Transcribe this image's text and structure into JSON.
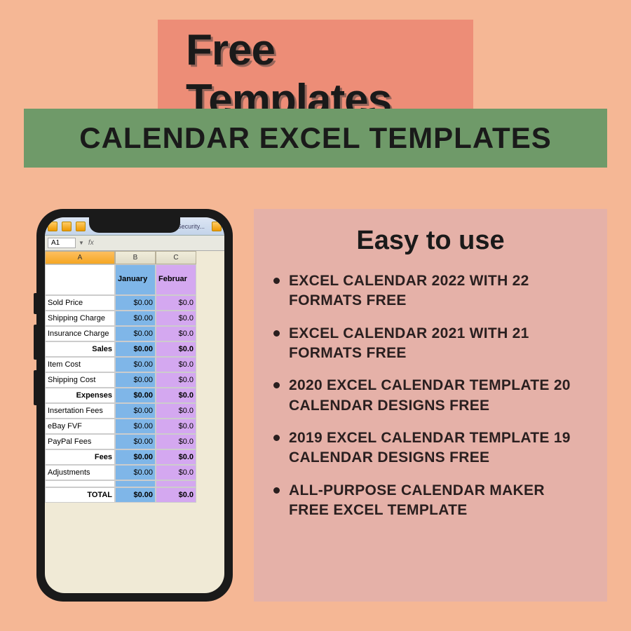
{
  "title": "Free Templates",
  "subtitle": "CALENDAR EXCEL TEMPLATES",
  "panel": {
    "heading": "Easy to use",
    "items": [
      "EXCEL CALENDAR 2022 WITH 22 FORMATS FREE",
      "EXCEL CALENDAR 2021 WITH 21 FORMATS FREE",
      "2020 EXCEL CALENDAR TEMPLATE 20 CALENDAR DESIGNS FREE",
      "2019 EXCEL CALENDAR TEMPLATE 19 CALENDAR DESIGNS FREE",
      "ALL-PURPOSE CALENDAR MAKER FREE EXCEL TEMPLATE"
    ]
  },
  "spreadsheet": {
    "toolbar_security": "Security...",
    "cell_ref": "A1",
    "fx": "fx",
    "columns": [
      "A",
      "B",
      "C"
    ],
    "months": [
      "January",
      "Februar"
    ],
    "rows": [
      {
        "label": "Sold Price",
        "b": "$0.00",
        "c": "$0.0",
        "bold": false
      },
      {
        "label": "Shipping Charge",
        "b": "$0.00",
        "c": "$0.0",
        "bold": false
      },
      {
        "label": "Insurance Charge",
        "b": "$0.00",
        "c": "$0.0",
        "bold": false
      },
      {
        "label": "Sales",
        "b": "$0.00",
        "c": "$0.0",
        "bold": true
      },
      {
        "label": "Item Cost",
        "b": "$0.00",
        "c": "$0.0",
        "bold": false
      },
      {
        "label": "Shipping Cost",
        "b": "$0.00",
        "c": "$0.0",
        "bold": false
      },
      {
        "label": "Expenses",
        "b": "$0.00",
        "c": "$0.0",
        "bold": true
      },
      {
        "label": "Insertation Fees",
        "b": "$0.00",
        "c": "$0.0",
        "bold": false
      },
      {
        "label": "eBay FVF",
        "b": "$0.00",
        "c": "$0.0",
        "bold": false
      },
      {
        "label": "PayPal Fees",
        "b": "$0.00",
        "c": "$0.0",
        "bold": false
      },
      {
        "label": "Fees",
        "b": "$0.00",
        "c": "$0.0",
        "bold": true
      },
      {
        "label": "Adjustments",
        "b": "$0.00",
        "c": "$0.0",
        "bold": false
      },
      {
        "label": "",
        "b": "",
        "c": "",
        "bold": false
      },
      {
        "label": "TOTAL",
        "b": "$0.00",
        "c": "$0.0",
        "bold": true
      }
    ]
  }
}
